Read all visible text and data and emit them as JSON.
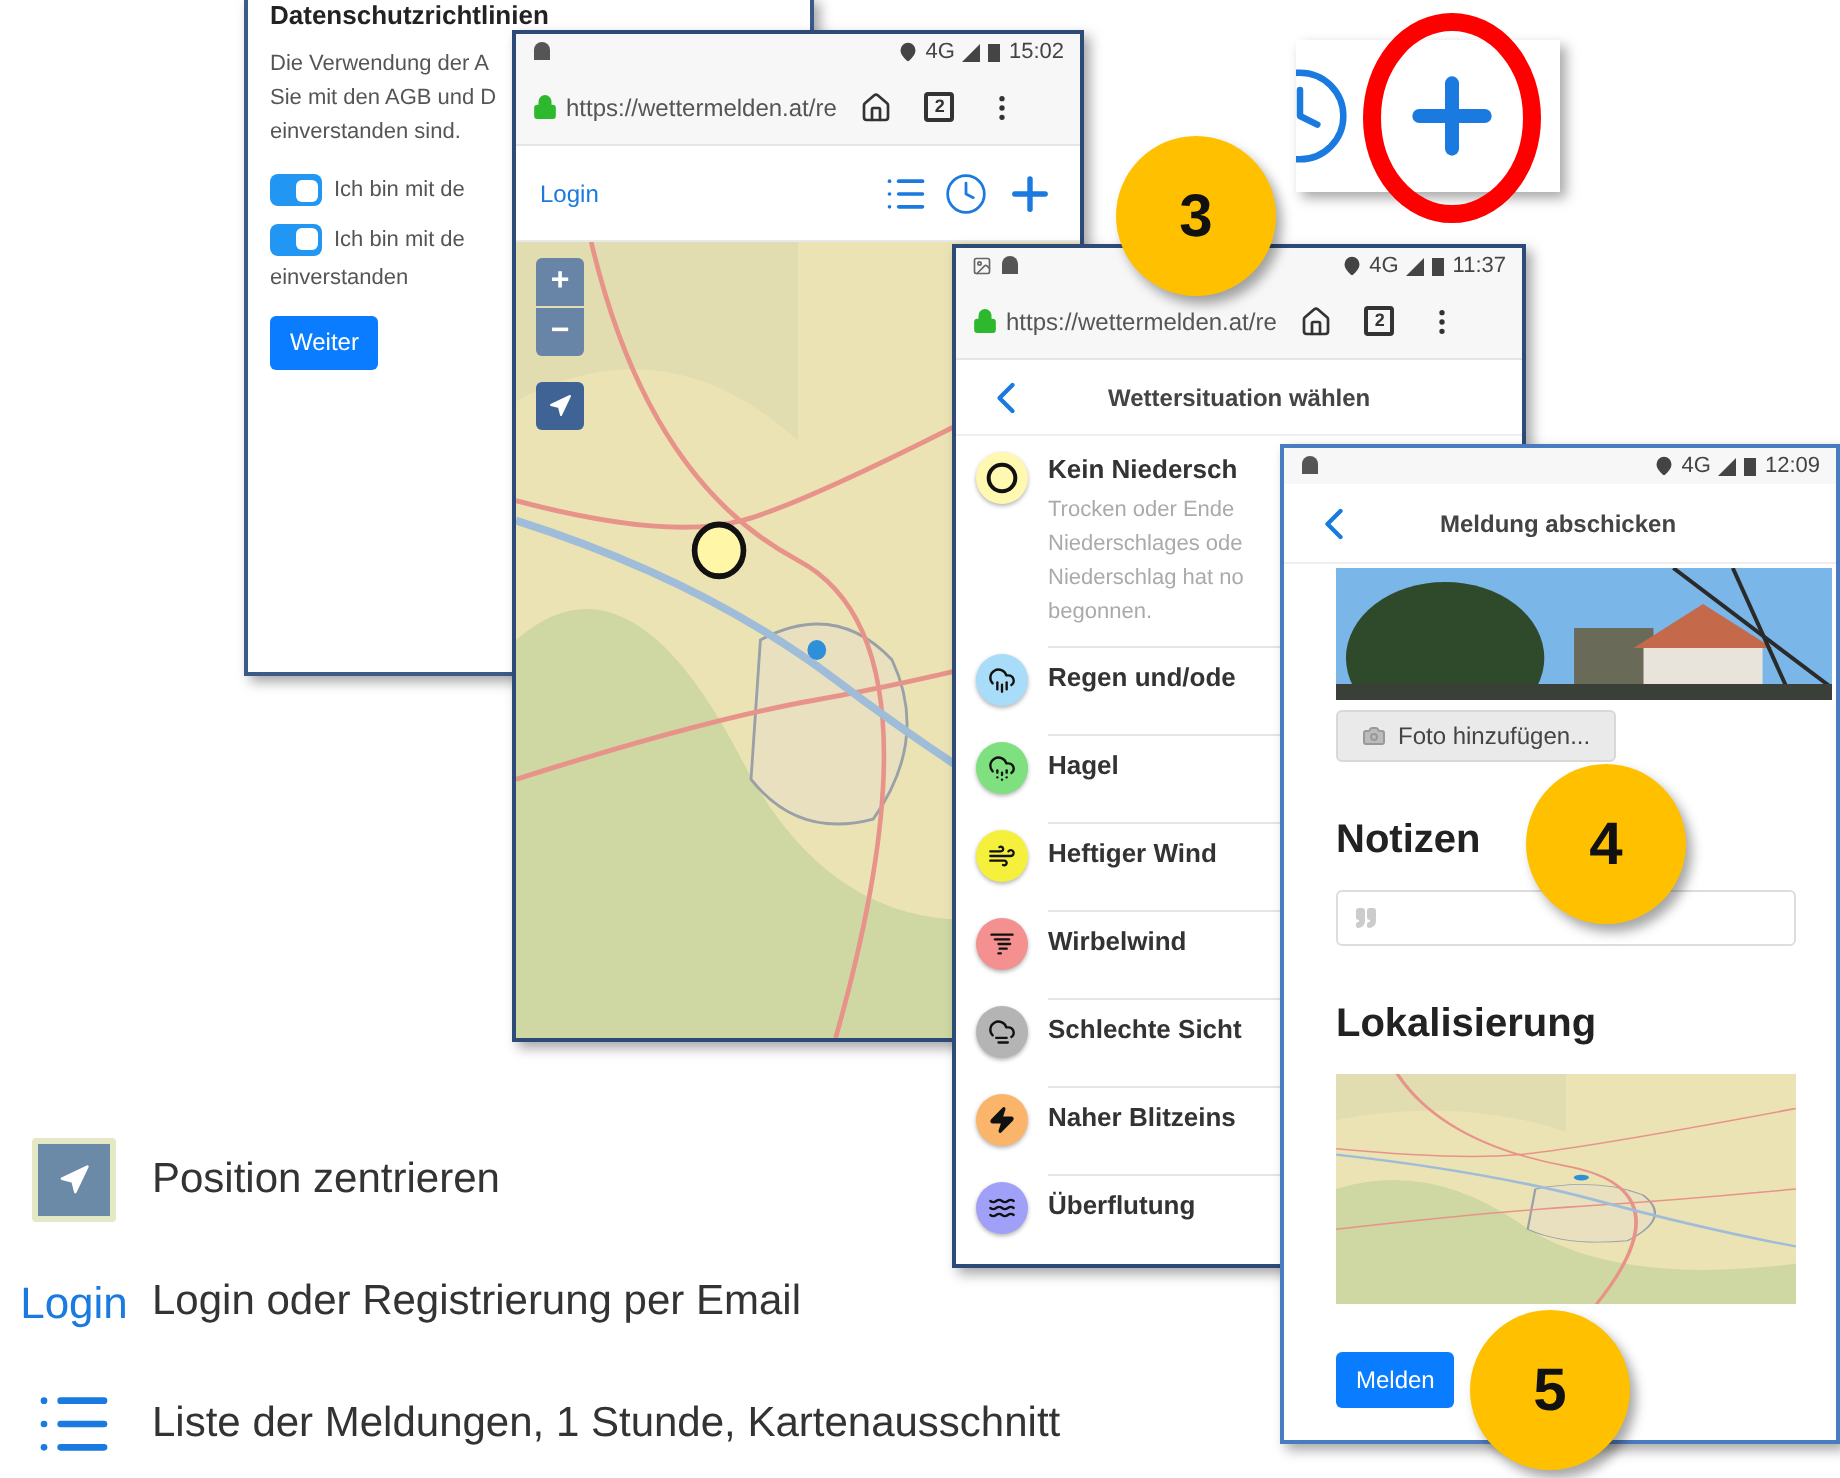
{
  "privacy_card": {
    "title": "Datenschutzrichtlinien",
    "lines": [
      "Die Verwendung der A",
      "Sie mit den AGB und D",
      "einverstanden sind."
    ],
    "toggles": [
      {
        "label": "Ich bin mit de",
        "on": true
      },
      {
        "label": "Ich bin mit de",
        "on": true
      }
    ],
    "after_toggles": "einverstanden",
    "button": "Weiter"
  },
  "map_screen": {
    "status": {
      "network": "4G",
      "time": "15:02"
    },
    "url": "https://wettermelden.at/re",
    "tab_count": "2",
    "login": "Login",
    "zoom_in": "+",
    "zoom_out": "−"
  },
  "category_screen": {
    "status": {
      "network": "4G",
      "time": "11:37"
    },
    "url": "https://wettermelden.at/re",
    "tab_count": "2",
    "title": "Wettersituation wählen",
    "items": [
      {
        "kind": "none",
        "title": "Kein Niedersch",
        "description": [
          "Trocken oder Ende",
          "Niederschlages ode",
          "Niederschlag hat no",
          "begonnen."
        ],
        "color": "#fff8b0"
      },
      {
        "kind": "rain",
        "title": "Regen und/ode",
        "color": "#a8dcf8"
      },
      {
        "kind": "hail",
        "title": "Hagel",
        "color": "#7ee07e"
      },
      {
        "kind": "wind",
        "title": "Heftiger Wind",
        "color": "#f5f03c"
      },
      {
        "kind": "tornado",
        "title": "Wirbelwind",
        "color": "#f49090"
      },
      {
        "kind": "fog",
        "title": "Schlechte Sicht",
        "color": "#b4b4b4"
      },
      {
        "kind": "lightning",
        "title": "Naher Blitzeins",
        "color": "#fbb56a"
      },
      {
        "kind": "flood",
        "title": "Überflutung",
        "color": "#a0a0f8"
      }
    ]
  },
  "report_screen": {
    "status": {
      "network": "4G",
      "time": "12:09"
    },
    "title": "Meldung abschicken",
    "photo_button": "Foto hinzufügen...",
    "notes_heading": "Notizen",
    "location_heading": "Lokalisierung",
    "button": "Melden"
  },
  "steps": [
    "3",
    "4",
    "5"
  ],
  "legend": [
    {
      "kind": "locate",
      "text": "Position zentrieren"
    },
    {
      "kind": "login",
      "label": "Login",
      "text": "Login oder Registrierung per Email"
    },
    {
      "kind": "list",
      "text": "Liste der Meldungen, 1 Stunde, Kartenausschnitt"
    }
  ]
}
